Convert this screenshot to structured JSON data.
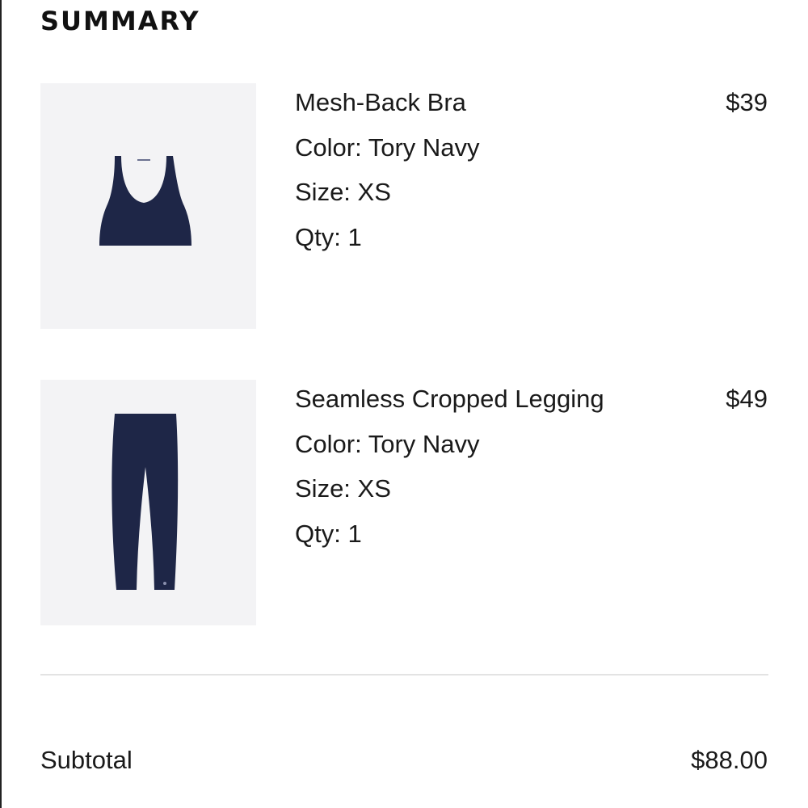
{
  "summary": {
    "title": "SUMMARY"
  },
  "items": [
    {
      "name": "Mesh-Back Bra",
      "color": "Color: Tory Navy",
      "size": "Size: XS",
      "qty": "Qty: 1",
      "price": "$39",
      "image_icon": "sports-bra-icon",
      "image_color": "#1e2647"
    },
    {
      "name": "Seamless Cropped Legging",
      "color": "Color: Tory Navy",
      "size": "Size: XS",
      "qty": "Qty: 1",
      "price": "$49",
      "image_icon": "leggings-icon",
      "image_color": "#1e2647"
    }
  ],
  "totals": {
    "subtotal_label": "Subtotal",
    "subtotal_value": "$88.00"
  }
}
